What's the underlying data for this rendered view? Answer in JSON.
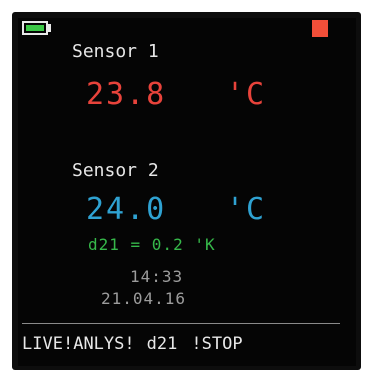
{
  "status": {
    "battery_icon": "battery-icon",
    "battery_level": 0.8,
    "record_icon": "record-indicator-icon",
    "record_color": "#f24f39"
  },
  "sensor1": {
    "label": "Sensor 1",
    "value": "23.8",
    "unit": "'C",
    "color": "#e8433b"
  },
  "sensor2": {
    "label": "Sensor 2",
    "value": "24.0",
    "unit": "'C",
    "color": "#2fa2d2"
  },
  "difference": {
    "text": "d21 = 0.2 'K",
    "color": "#36b84a"
  },
  "clock": {
    "time": "14:33",
    "date": "21.04.16"
  },
  "nav": {
    "live": "LIVE",
    "anlys": "ANLYS",
    "d21": "d21",
    "stop": "STOP",
    "separator": "!"
  }
}
